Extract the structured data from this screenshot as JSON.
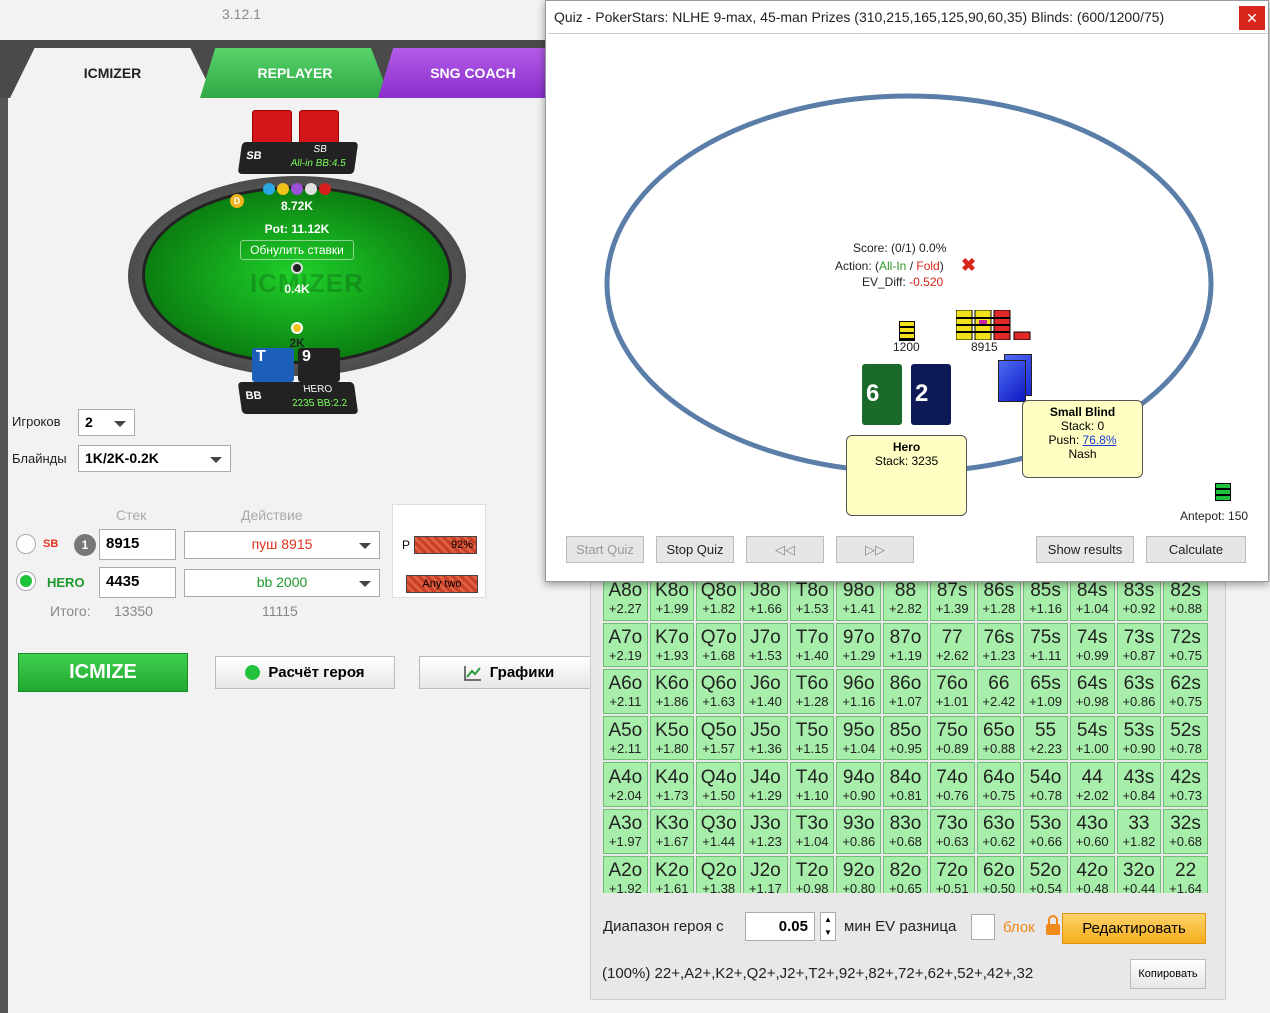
{
  "app": {
    "version": "3.12.1"
  },
  "tabs": [
    {
      "label": "ICMIZER"
    },
    {
      "label": "REPLAYER"
    },
    {
      "label": "SNG COACH"
    }
  ],
  "table": {
    "sb": {
      "position": "SB",
      "name": "SB",
      "stack": "All-in BB:4.5"
    },
    "hero": {
      "position": "BB",
      "name": "HERO",
      "stack": "2235 BB:2.2"
    },
    "dealer": "D",
    "sb_bet": "8.72K",
    "pot": "Pot: 11.12K",
    "reset_label": "Обнулить ставки",
    "mid_bet": "0.4K",
    "hero_bet": "2K",
    "watermark": "ICMIZER",
    "hero_cards": [
      {
        "rank": "T",
        "color": "#1c5fb8"
      },
      {
        "rank": "9",
        "color": "#222"
      }
    ]
  },
  "settings": {
    "players_label": "Игроков",
    "players_value": "2",
    "blinds_label": "Блайнды",
    "blinds_value": "1K/2K-0.2K"
  },
  "headers": {
    "stack": "Стек",
    "action": "Действие"
  },
  "rows": [
    {
      "name": "SB",
      "stack": "8915",
      "action": "пуш 8915",
      "badge": "1",
      "name_color": "#e0341e"
    },
    {
      "name": "HERO",
      "stack": "4435",
      "action": "bb 2000",
      "badge": "",
      "name_color": "#1a9a2a"
    }
  ],
  "totals": {
    "label": "Итого:",
    "stack": "13350",
    "action": "11115"
  },
  "range_box": {
    "p_label": "P",
    "p_pct": "92%",
    "any_two": "Any two"
  },
  "buttons": {
    "icmize": "ICMIZE",
    "hero_calc": "Расчёт героя",
    "graphs": "Графики"
  },
  "grid": [
    [
      "A8o",
      "+2.27"
    ],
    [
      "K8o",
      "+1.99"
    ],
    [
      "Q8o",
      "+1.82"
    ],
    [
      "J8o",
      "+1.66"
    ],
    [
      "T8o",
      "+1.53"
    ],
    [
      "98o",
      "+1.41"
    ],
    [
      "88",
      "+2.82"
    ],
    [
      "87s",
      "+1.39"
    ],
    [
      "86s",
      "+1.28"
    ],
    [
      "85s",
      "+1.16"
    ],
    [
      "84s",
      "+1.04"
    ],
    [
      "83s",
      "+0.92"
    ],
    [
      "82s",
      "+0.88"
    ],
    [
      "A7o",
      "+2.19"
    ],
    [
      "K7o",
      "+1.93"
    ],
    [
      "Q7o",
      "+1.68"
    ],
    [
      "J7o",
      "+1.53"
    ],
    [
      "T7o",
      "+1.40"
    ],
    [
      "97o",
      "+1.29"
    ],
    [
      "87o",
      "+1.19"
    ],
    [
      "77",
      "+2.62"
    ],
    [
      "76s",
      "+1.23"
    ],
    [
      "75s",
      "+1.11"
    ],
    [
      "74s",
      "+0.99"
    ],
    [
      "73s",
      "+0.87"
    ],
    [
      "72s",
      "+0.75"
    ],
    [
      "A6o",
      "+2.11"
    ],
    [
      "K6o",
      "+1.86"
    ],
    [
      "Q6o",
      "+1.63"
    ],
    [
      "J6o",
      "+1.40"
    ],
    [
      "T6o",
      "+1.28"
    ],
    [
      "96o",
      "+1.16"
    ],
    [
      "86o",
      "+1.07"
    ],
    [
      "76o",
      "+1.01"
    ],
    [
      "66",
      "+2.42"
    ],
    [
      "65s",
      "+1.09"
    ],
    [
      "64s",
      "+0.98"
    ],
    [
      "63s",
      "+0.86"
    ],
    [
      "62s",
      "+0.75"
    ],
    [
      "A5o",
      "+2.11"
    ],
    [
      "K5o",
      "+1.80"
    ],
    [
      "Q5o",
      "+1.57"
    ],
    [
      "J5o",
      "+1.36"
    ],
    [
      "T5o",
      "+1.15"
    ],
    [
      "95o",
      "+1.04"
    ],
    [
      "85o",
      "+0.95"
    ],
    [
      "75o",
      "+0.89"
    ],
    [
      "65o",
      "+0.88"
    ],
    [
      "55",
      "+2.23"
    ],
    [
      "54s",
      "+1.00"
    ],
    [
      "53s",
      "+0.90"
    ],
    [
      "52s",
      "+0.78"
    ],
    [
      "A4o",
      "+2.04"
    ],
    [
      "K4o",
      "+1.73"
    ],
    [
      "Q4o",
      "+1.50"
    ],
    [
      "J4o",
      "+1.29"
    ],
    [
      "T4o",
      "+1.10"
    ],
    [
      "94o",
      "+0.90"
    ],
    [
      "84o",
      "+0.81"
    ],
    [
      "74o",
      "+0.76"
    ],
    [
      "64o",
      "+0.75"
    ],
    [
      "54o",
      "+0.78"
    ],
    [
      "44",
      "+2.02"
    ],
    [
      "43s",
      "+0.84"
    ],
    [
      "42s",
      "+0.73"
    ],
    [
      "A3o",
      "+1.97"
    ],
    [
      "K3o",
      "+1.67"
    ],
    [
      "Q3o",
      "+1.44"
    ],
    [
      "J3o",
      "+1.23"
    ],
    [
      "T3o",
      "+1.04"
    ],
    [
      "93o",
      "+0.86"
    ],
    [
      "83o",
      "+0.68"
    ],
    [
      "73o",
      "+0.63"
    ],
    [
      "63o",
      "+0.62"
    ],
    [
      "53o",
      "+0.66"
    ],
    [
      "43o",
      "+0.60"
    ],
    [
      "33",
      "+1.82"
    ],
    [
      "32s",
      "+0.68"
    ],
    [
      "A2o",
      "+1.92"
    ],
    [
      "K2o",
      "+1.61"
    ],
    [
      "Q2o",
      "+1.38"
    ],
    [
      "J2o",
      "+1.17"
    ],
    [
      "T2o",
      "+0.98"
    ],
    [
      "92o",
      "+0.80"
    ],
    [
      "82o",
      "+0.65"
    ],
    [
      "72o",
      "+0.51"
    ],
    [
      "62o",
      "+0.50"
    ],
    [
      "52o",
      "+0.54"
    ],
    [
      "42o",
      "+0.48"
    ],
    [
      "32o",
      "+0.44"
    ],
    [
      "22",
      "+1.64"
    ]
  ],
  "range_controls": {
    "label": "Диапазон героя с",
    "value": "0.05",
    "min_ev": "мин EV разница",
    "block": "блок",
    "edit": "Редактировать",
    "copy": "Копировать"
  },
  "range_text": "(100%) 22+,A2+,K2+,Q2+,J2+,T2+,92+,82+,72+,62+,52+,42+,32",
  "quiz": {
    "title": "Quiz - PokerStars: NLHE 9-max, 45-man Prizes (310,215,165,125,90,60,35) Blinds: (600/1200/75)",
    "score": "Score: (0/1) 0.0%",
    "action_prefix": "Action: (",
    "action_allin": "All-In",
    "action_sep": " / ",
    "action_fold": "Fold",
    "action_suffix": ")",
    "ev_label": "EV_Diff: ",
    "ev_value": "-0.520",
    "bet_hero": "1200",
    "bet_sb": "8915",
    "hero_cards": [
      {
        "rank": "6",
        "color": "#1a6b2a"
      },
      {
        "rank": "2",
        "color": "#0d1a55"
      }
    ],
    "hero_box": {
      "name": "Hero",
      "stack": "Stack: 3235"
    },
    "sb_box": {
      "name": "Small Blind",
      "stack": "Stack: 0",
      "push_label": "Push: ",
      "push_value": "76.8%",
      "mode": "Nash"
    },
    "antepot": "Antepot: 150",
    "buttons": {
      "start": "Start Quiz",
      "stop": "Stop Quiz",
      "prev": "◁◁",
      "next": "▷▷",
      "results": "Show results",
      "calc": "Calculate"
    }
  }
}
